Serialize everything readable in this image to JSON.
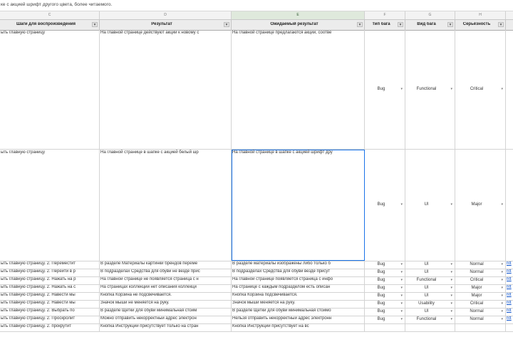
{
  "formula_bar": {
    "text": "ке с акцией шрифт другого цвета, более читаемого."
  },
  "column_letters": [
    "C",
    "D",
    "E",
    "F",
    "G",
    "H",
    ""
  ],
  "headers": [
    "Шаги для воспроизведения",
    "Результат",
    "Ожидаемый результат",
    "Тип бага",
    "Вид бага",
    "Серьёзность",
    ""
  ],
  "rows": [
    {
      "steps": "ыть главную страницу",
      "result": "На главной странице действуют акции к новому с",
      "expected": "На главной странице предлагаются акции, соотве",
      "type": "Bug",
      "kind": "Functional",
      "severity": "Critical",
      "link": ""
    },
    {
      "steps": "ыть главную страницу",
      "result": "На главной странице в шапке с акцией белый шр",
      "expected": "На главной странице в шапке с акцией шрифт дру",
      "type": "Bug",
      "kind": "UI",
      "severity": "Major",
      "link": ""
    },
    {
      "steps": "ыть главную страницу. 2. Переместит",
      "result": "В разделе Материалы картинки брендов переме",
      "expected": "В разделе материалы изображены либо только б",
      "type": "Bug",
      "kind": "UI",
      "severity": "Normal",
      "link": "htt"
    },
    {
      "steps": "ыть главную страницу. 2. Перейти в р",
      "result": "В подразделах Средства для обуви не везде прис",
      "expected": "В подразделах Средства для обуви везде присут",
      "type": "Bug",
      "kind": "UI",
      "severity": "Normal",
      "link": "htt"
    },
    {
      "steps": "ыть главную страницу. 2. Нажать на р",
      "result": "На главной странице не появляется страница с н",
      "expected": "На главной странице появляется страница с инфо",
      "type": "Bug",
      "kind": "Functional",
      "severity": "Critical",
      "link": "htt"
    },
    {
      "steps": "ыть главную страницу. 2. Нажать на с",
      "result": "На страницах коллекций нет описания коллекци",
      "expected": "На странице с каждым подразделом есть описан",
      "type": "Bug",
      "kind": "UI",
      "severity": "Major",
      "link": "htt"
    },
    {
      "steps": "ыть главную страницу. 2. Навести мы",
      "result": "Кнопка Корзина не подсвечивается.",
      "expected": "Кнопка Корзина подсвечивается.",
      "type": "Bug",
      "kind": "UI",
      "severity": "Major",
      "link": "htt"
    },
    {
      "steps": "ыть главную страницу. 2. Навести мы",
      "result": "Значок мыши не меняется на руку.",
      "expected": "Значок мыши меняется на руку.",
      "type": "Bug",
      "kind": "Usability",
      "severity": "Critical",
      "link": "htt"
    },
    {
      "steps": "ыть главную страницу. 2. Выбрать по",
      "result": "В разделе Щетки для обуви минимальная стоим",
      "expected": "В разделе Щетки для обуви минимальная стоимо",
      "type": "Bug",
      "kind": "UI",
      "severity": "Normal",
      "link": "htt"
    },
    {
      "steps": "ыть главную страницу. 2. Проскролит",
      "result": "Можно отправить некорректный адрес электрон",
      "expected": "Нельзя отправить некорректный адрес электронн",
      "type": "Bug",
      "kind": "Functional",
      "severity": "Normal",
      "link": "htt"
    },
    {
      "steps": "ыть главную страницу. 2. прокрутит",
      "result": "Кнопка Инструкции присутствует только на стран",
      "expected": "Кнопка Инструкции присутствует на вс",
      "type": "",
      "kind": "",
      "severity": "",
      "link": ""
    }
  ]
}
